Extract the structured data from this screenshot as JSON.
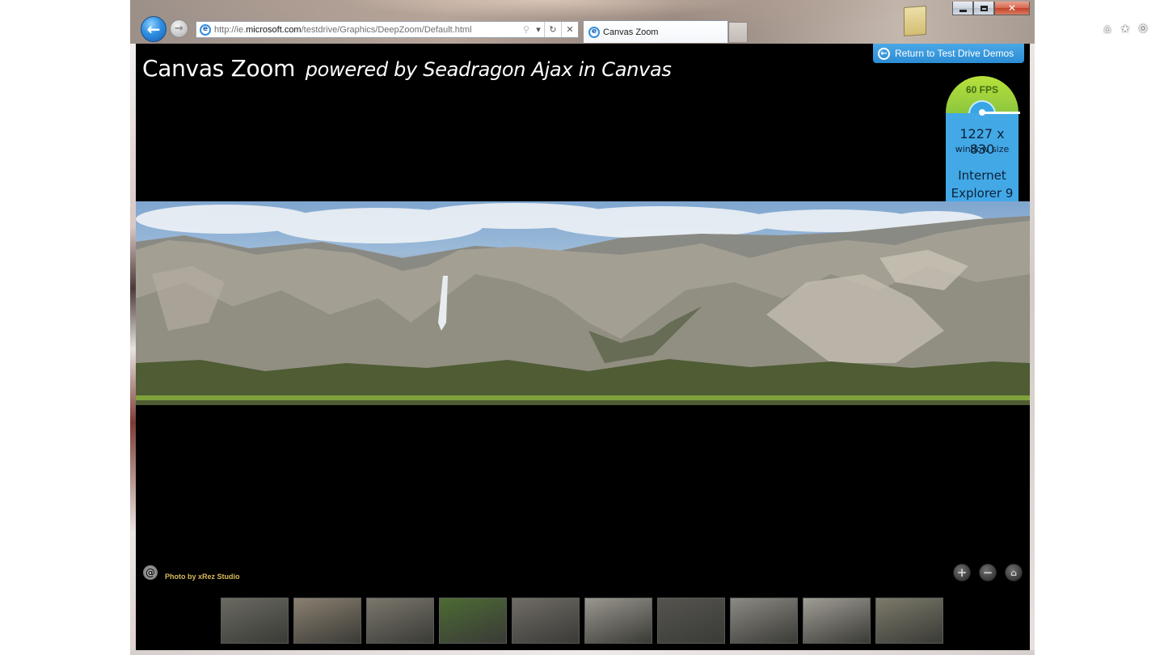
{
  "browser": {
    "url_prefix": "http://ie.",
    "url_host": "microsoft.com",
    "url_path": "/testdrive/Graphics/DeepZoom/Default.html",
    "tab_title": "Canvas Zoom",
    "icons": {
      "back": "back-arrow-icon",
      "forward": "forward-arrow-icon",
      "search": "search-icon",
      "dropdown": "dropdown-icon",
      "refresh": "refresh-icon",
      "stop": "stop-icon",
      "home": "home-icon",
      "favorites": "star-icon",
      "tools": "gear-icon"
    }
  },
  "page": {
    "title": "Canvas Zoom",
    "subtitle": "powered by Seadragon Ajax in Canvas",
    "return_label": "Return to Test Drive Demos"
  },
  "fps_widget": {
    "fps": "60 FPS",
    "size": "1227 x 830",
    "size_label": "window size",
    "browser_line1": "Internet",
    "browser_line2": "Explorer 9"
  },
  "viewer": {
    "credit": "Photo by xRez Studio",
    "controls": [
      "zoom-in",
      "zoom-out",
      "home"
    ]
  },
  "thumbnails": [
    {
      "name": "thumb-1",
      "color": "#6a6a62"
    },
    {
      "name": "thumb-2",
      "color": "#8a8070"
    },
    {
      "name": "thumb-3",
      "color": "#7a776c"
    },
    {
      "name": "thumb-4",
      "color": "#4c6b34"
    },
    {
      "name": "thumb-5",
      "color": "#706c66"
    },
    {
      "name": "thumb-6",
      "color": "#9a978f"
    },
    {
      "name": "thumb-7",
      "color": "#55544f"
    },
    {
      "name": "thumb-8",
      "color": "#8c8a84"
    },
    {
      "name": "thumb-9",
      "color": "#a09d95"
    },
    {
      "name": "thumb-10",
      "color": "#7c7a6a"
    }
  ],
  "colors": {
    "accent_blue": "#2c8cd4",
    "fps_green": "#8cc63f",
    "credit_gold": "#d9b95a"
  }
}
